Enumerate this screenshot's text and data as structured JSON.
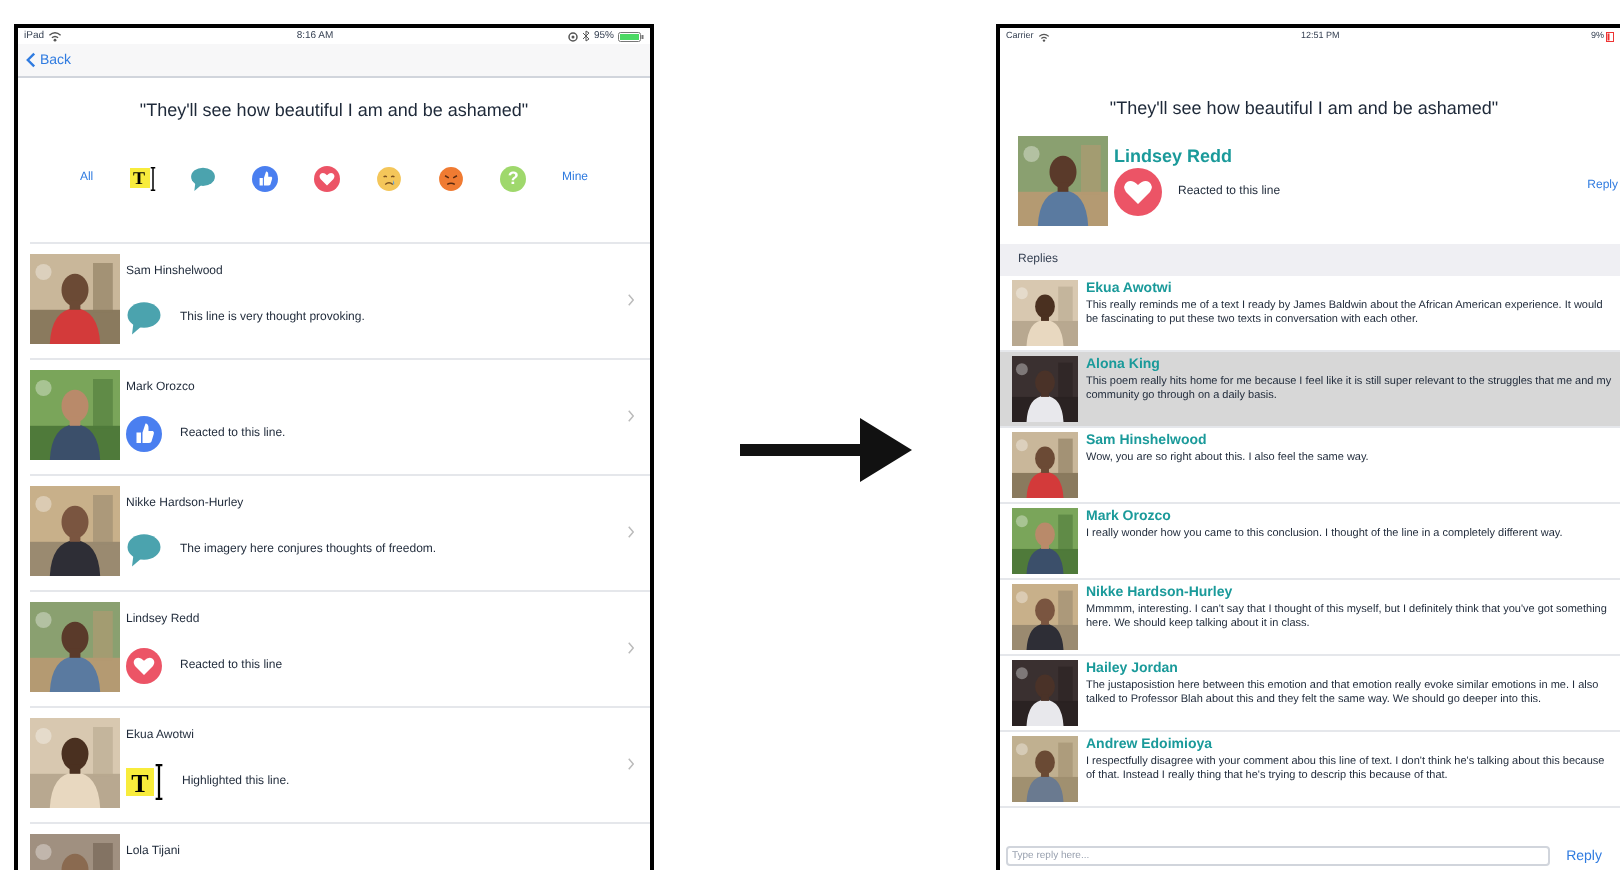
{
  "left_screen": {
    "status_bar": {
      "device": "iPad",
      "time": "8:16 AM",
      "battery": "95%"
    },
    "nav": {
      "back": "Back"
    },
    "quote": "\"They'll see how beautiful I am and be ashamed\"",
    "filters": [
      {
        "kind": "text",
        "label": "All"
      },
      {
        "kind": "highlight",
        "glyph": "T"
      },
      {
        "kind": "comment"
      },
      {
        "kind": "like"
      },
      {
        "kind": "heart"
      },
      {
        "kind": "sad"
      },
      {
        "kind": "angry"
      },
      {
        "kind": "question",
        "glyph": "?"
      },
      {
        "kind": "text",
        "label": "Mine"
      }
    ],
    "responses": [
      {
        "name": "Sam Hinshelwood",
        "reaction": {
          "kind": "comment"
        },
        "text": "This line is very thought provoking."
      },
      {
        "name": "Mark Orozco",
        "reaction": {
          "kind": "like"
        },
        "text": "Reacted to this line."
      },
      {
        "name": "Nikke Hardson-Hurley",
        "reaction": {
          "kind": "comment"
        },
        "text": "The imagery here conjures thoughts of freedom."
      },
      {
        "name": "Lindsey Redd",
        "reaction": {
          "kind": "heart"
        },
        "text": "Reacted to this line"
      },
      {
        "name": "Ekua Awotwi",
        "reaction": {
          "kind": "highlight",
          "glyph": "T"
        },
        "text": "Highlighted this line."
      },
      {
        "name": "Lola Tijani"
      }
    ]
  },
  "right_screen": {
    "status_bar": {
      "carrier": "Carrier",
      "time": "12:51 PM",
      "battery": "9%"
    },
    "quote": "\"They'll see how beautiful I am and be ashamed\"",
    "author": {
      "name": "Lindsey Redd",
      "reaction": {
        "kind": "heart"
      },
      "text": "Reacted to this line",
      "reply_button": "Reply"
    },
    "replies_header": "Replies",
    "replies": [
      {
        "name": "Ekua Awotwi",
        "selected": false,
        "text": "This really reminds me of a text I ready by James Baldwin about the African American experience. It would be fascinating to put these two texts in conversation with each other."
      },
      {
        "name": "Alona King",
        "selected": true,
        "text": "This poem really hits home for me because I feel like it is still super relevant to the struggles that me and my community go through on a daily basis."
      },
      {
        "name": "Sam Hinshelwood",
        "selected": false,
        "text": "Wow, you are so right about this. I also feel the same way."
      },
      {
        "name": "Mark Orozco",
        "selected": false,
        "text": "I really wonder how you came to this conclusion. I thought of the line in a completely different way."
      },
      {
        "name": "Nikke Hardson-Hurley",
        "selected": false,
        "text": "Mmmmm, interesting. I can't say that I thought of this myself, but I definitely think that you've got something here. We should keep talking about it in class."
      },
      {
        "name": "Hailey Jordan",
        "selected": false,
        "text": "The justaposistion here between this emotion and that emotion really evoke similar emotions in me. I also talked to Professor Blah about this and they felt the same way. We should go deeper into this."
      },
      {
        "name": "Andrew Edoimioya",
        "selected": false,
        "text": "I respectfully disagree with your comment abou this line of text. I don't think he's talking about this because of that. Instead I really thing that he's trying to descrip this because of that."
      }
    ],
    "reply_input": {
      "placeholder": "Type reply here...",
      "button": "Reply"
    }
  }
}
